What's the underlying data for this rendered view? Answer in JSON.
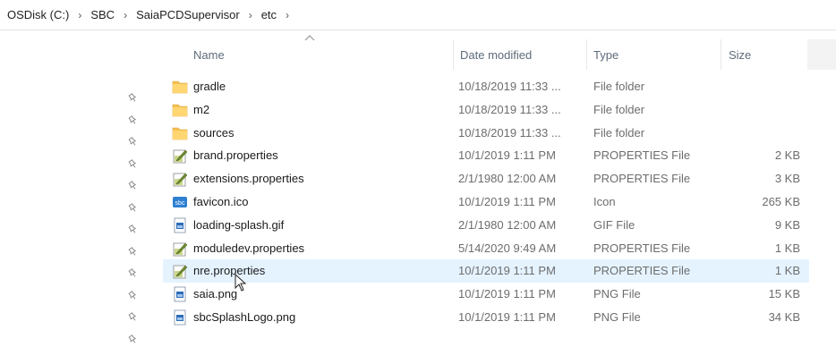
{
  "breadcrumb": {
    "items": [
      "OSDisk (C:)",
      "SBC",
      "SaiaPCDSupervisor",
      "etc"
    ],
    "separator": "›"
  },
  "columns": {
    "name": "Name",
    "date": "Date modified",
    "type": "Type",
    "size": "Size"
  },
  "files": [
    {
      "name": "gradle",
      "date": "10/18/2019 11:33 ...",
      "type": "File folder",
      "size": "",
      "icon": "folder-icon"
    },
    {
      "name": "m2",
      "date": "10/18/2019 11:33 ...",
      "type": "File folder",
      "size": "",
      "icon": "folder-icon"
    },
    {
      "name": "sources",
      "date": "10/18/2019 11:33 ...",
      "type": "File folder",
      "size": "",
      "icon": "folder-icon"
    },
    {
      "name": "brand.properties",
      "date": "10/1/2019 1:11 PM",
      "type": "PROPERTIES File",
      "size": "2 KB",
      "icon": "properties-file-icon"
    },
    {
      "name": "extensions.properties",
      "date": "2/1/1980 12:00 AM",
      "type": "PROPERTIES File",
      "size": "3 KB",
      "icon": "properties-file-icon"
    },
    {
      "name": "favicon.ico",
      "date": "10/1/2019 1:11 PM",
      "type": "Icon",
      "size": "265 KB",
      "icon": "ico-file-icon"
    },
    {
      "name": "loading-splash.gif",
      "date": "2/1/1980 12:00 AM",
      "type": "GIF File",
      "size": "9 KB",
      "icon": "image-file-icon"
    },
    {
      "name": "moduledev.properties",
      "date": "5/14/2020 9:49 AM",
      "type": "PROPERTIES File",
      "size": "1 KB",
      "icon": "properties-file-icon"
    },
    {
      "name": "nre.properties",
      "date": "10/1/2019 1:11 PM",
      "type": "PROPERTIES File",
      "size": "1 KB",
      "icon": "properties-file-icon"
    },
    {
      "name": "saia.png",
      "date": "10/1/2019 1:11 PM",
      "type": "PNG File",
      "size": "15 KB",
      "icon": "image-file-icon"
    },
    {
      "name": "sbcSplashLogo.png",
      "date": "10/1/2019 1:11 PM",
      "type": "PNG File",
      "size": "34 KB",
      "icon": "image-file-icon"
    }
  ],
  "hovered_row": "nre.properties",
  "colors": {
    "folder": "#f4c04f",
    "hover": "#e5f3ff",
    "pin": "#8a8a8a"
  }
}
